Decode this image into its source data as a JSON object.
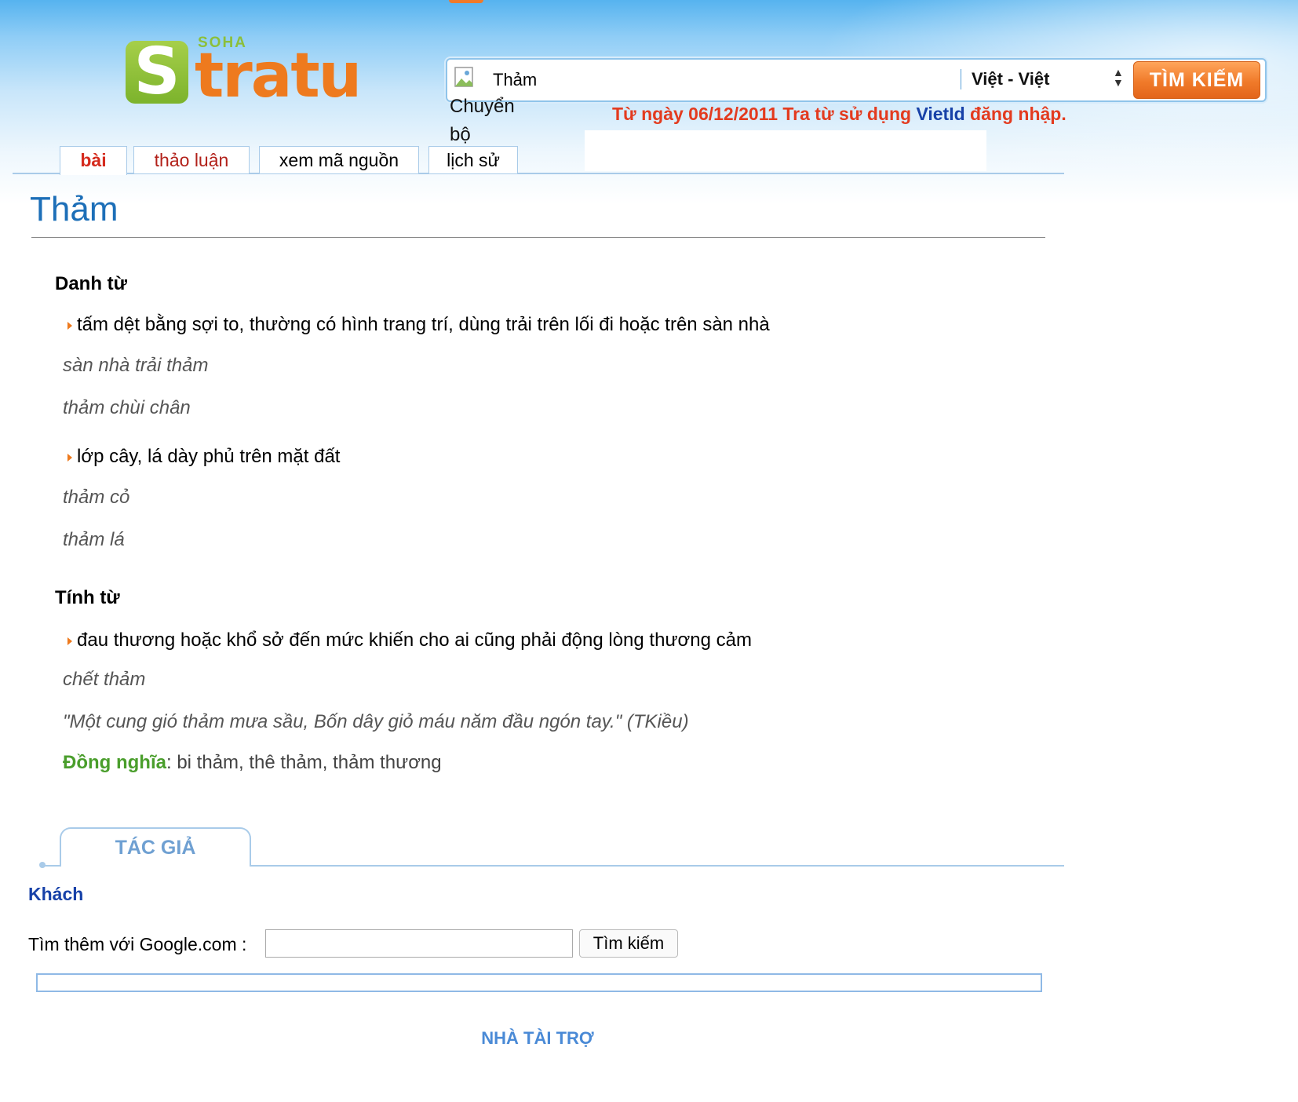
{
  "logo": {
    "s_letter": "S",
    "soha": "SOHA",
    "word": "tratu"
  },
  "search": {
    "query": "Thảm",
    "image_alt": "Chuyển bộ",
    "language": "Việt - Việt",
    "button_label": "TÌM KIẾM"
  },
  "notice": {
    "before": "Từ ngày 06/12/2011 Tra từ sử dụng ",
    "vietid": "VietId",
    "after": " đăng nhập."
  },
  "tabs": [
    {
      "label": "bài"
    },
    {
      "label": "thảo luận"
    },
    {
      "label": "xem mã nguồn"
    },
    {
      "label": "lịch sử"
    }
  ],
  "entry": {
    "title": "Thảm",
    "noun": {
      "label": "Danh từ",
      "senses": [
        {
          "definition": "tấm dệt bằng sợi to, thường có hình trang trí, dùng trải trên lối đi hoặc trên sàn nhà",
          "examples": [
            "sàn nhà trải thảm",
            "thảm chùi chân"
          ]
        },
        {
          "definition": "lớp cây, lá dày phủ trên mặt đất",
          "examples": [
            "thảm cỏ",
            "thảm lá"
          ]
        }
      ]
    },
    "adjective": {
      "label": "Tính từ",
      "senses": [
        {
          "definition": "đau thương hoặc khổ sở đến mức khiến cho ai cũng phải động lòng thương cảm",
          "examples": [
            "chết thảm",
            "\"Một cung gió thảm mưa sầu, Bốn dây giỏ máu năm đầu ngón tay.\" (TKiều)"
          ]
        }
      ]
    },
    "synonyms": {
      "label": "Đồng nghĩa",
      "separator": ": ",
      "values": "bi thảm, thê thảm, thảm thương"
    }
  },
  "author": {
    "tab_label": "TÁC GIẢ",
    "name": "Khách"
  },
  "google": {
    "label": "Tìm thêm với Google.com :",
    "button_label": "Tìm kiếm",
    "value": ""
  },
  "sponsor": {
    "label": "NHÀ TÀI TRỢ"
  },
  "colors": {
    "accent_orange": "#ee7a1e",
    "link_blue": "#1d6fb8",
    "notice_red": "#e33b1f",
    "synonym_green": "#4a9e2c"
  }
}
